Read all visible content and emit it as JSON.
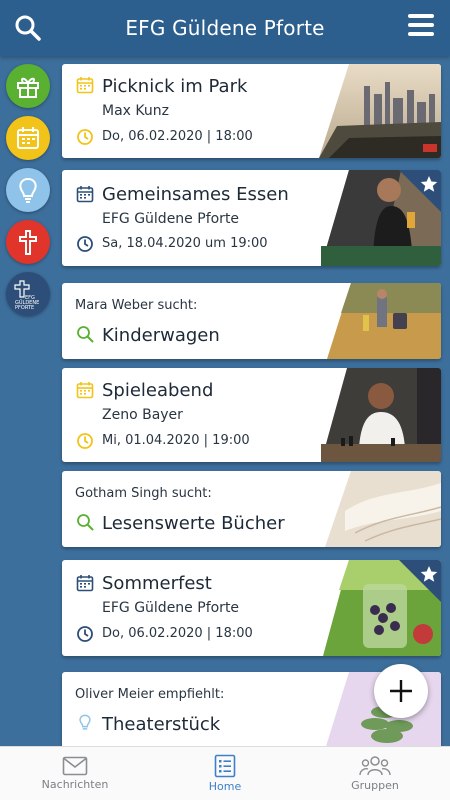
{
  "header": {
    "title": "EFG Güldene Pforte",
    "search_icon": "search-icon",
    "menu_icon": "hamburger-menu-icon"
  },
  "sidebar": {
    "items": [
      {
        "name": "gift",
        "color": "#5ab031"
      },
      {
        "name": "calendar",
        "color": "#f2c318"
      },
      {
        "name": "lightbulb",
        "color": "#8fc3ea"
      },
      {
        "name": "cross",
        "color": "#e1352c"
      },
      {
        "name": "group-logo",
        "color": "#2d4e78",
        "logo_text": "EFG GÜLDENE PFORTE"
      }
    ]
  },
  "cards": [
    {
      "type": "event",
      "title": "Picknick im Park",
      "subtitle": "Max Kunz",
      "date": "Do, 06.02.2020 | 18:00",
      "accent": "#f2c318",
      "starred": false
    },
    {
      "type": "event",
      "title": "Gemeinsames Essen",
      "subtitle": "EFG Güldene Pforte",
      "date": "Sa, 18.04.2020 um 19:00",
      "accent": "#2d4e78",
      "starred": true
    },
    {
      "type": "search",
      "person": "Mara Weber",
      "verb": "sucht:",
      "title": "Kinderwagen",
      "accent": "#5ab031"
    },
    {
      "type": "event",
      "title": "Spieleabend",
      "subtitle": "Zeno Bayer",
      "date": "Mi, 01.04.2020 | 19:00",
      "accent": "#f2c318",
      "starred": false
    },
    {
      "type": "search",
      "person": "Gotham Singh",
      "verb": "sucht:",
      "title": "Lesenswerte Bücher",
      "accent": "#5ab031"
    },
    {
      "type": "event",
      "title": "Sommerfest",
      "subtitle": "EFG Güldene Pforte",
      "date": "Do, 06.02.2020 | 18:00",
      "accent": "#2d4e78",
      "starred": true
    },
    {
      "type": "recommend",
      "person": "Oliver Meier",
      "verb": "empfiehlt:",
      "title": "Theaterstück",
      "accent": "#8fc3ea"
    }
  ],
  "fab": {
    "icon": "plus-icon"
  },
  "bottom_nav": [
    {
      "label": "Nachrichten",
      "icon": "envelope-icon",
      "active": false
    },
    {
      "label": "Home",
      "icon": "list-icon",
      "active": true
    },
    {
      "label": "Gruppen",
      "icon": "people-icon",
      "active": false
    }
  ]
}
